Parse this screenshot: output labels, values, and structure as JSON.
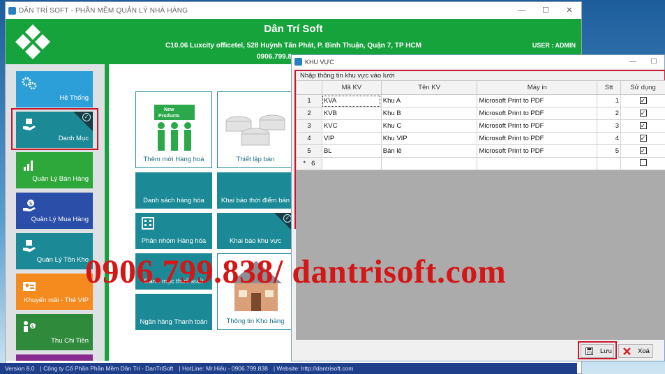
{
  "main_window": {
    "title": "DÂN TRÍ SOFT - PHẦN MỀM QUẢN LÝ NHÀ HÀNG",
    "controls": [
      "—",
      "☐",
      "✕"
    ]
  },
  "header": {
    "company_name": "Dân Trí Soft",
    "address": "C10.06 Luxcity officetel, 528 Huỳnh Tấn Phát, P. Bình Thuận, Quận 7, TP HCM",
    "phone": "0906.799.8",
    "user": "USER : ADMIN"
  },
  "sidebar": {
    "items": [
      {
        "label": "Hệ Thống",
        "icon": "gears-icon",
        "color": "#2c9fd8"
      },
      {
        "label": "Danh Mục",
        "icon": "box-hand-icon",
        "color": "#1b8a96"
      },
      {
        "label": "Quản Lý Bán Hàng",
        "icon": "bar-chart-icon",
        "color": "#2fa83b"
      },
      {
        "label": "Quản Lý Mua Hàng",
        "icon": "dollar-hand-icon",
        "color": "#2b4fa8"
      },
      {
        "label": "Quản Lý Tồn Kho",
        "icon": "box-hand-icon",
        "color": "#1b8a96"
      },
      {
        "label": "Khuyến mãi - Thẻ VIP",
        "icon": "vip-card-icon",
        "color": "#f58a1f"
      },
      {
        "label": "Thu Chi Tiền",
        "icon": "money-people-icon",
        "color": "#2f8a3b"
      }
    ]
  },
  "tiles": [
    {
      "label": "Thêm mới Hàng hoá",
      "style": "light",
      "icon": "new-products-icon"
    },
    {
      "label": "Thiết lập bàn",
      "style": "light",
      "icon": "tables-icon"
    },
    {
      "label": "Danh sách hàng hóa",
      "style": "teal"
    },
    {
      "label": "Khai báo thời điểm bán",
      "style": "teal"
    },
    {
      "label": "Phân nhóm Hàng hóa",
      "style": "teal",
      "icon": "building-icon"
    },
    {
      "label": "Khai báo khu vực",
      "style": "teal"
    },
    {
      "label": "Danh mục thuế suất",
      "style": "teal"
    },
    {
      "label": "Ngân hàng Thanh toán",
      "style": "teal"
    },
    {
      "label": "Thông tin Kho hàng",
      "style": "light",
      "icon": "house-icon"
    }
  ],
  "statusbar": {
    "version": "Version 8.0",
    "company": "Công ty Cổ Phần Phần Mềm Dân Trí - DanTriSoft",
    "hotline": "HotLine: Mr.Hiếu - 0906.799.838",
    "website": "Website: http://dantrisoft.com"
  },
  "kv_window": {
    "title": "KHU VỰC",
    "group_label": "Nhập thông tin khu vực vào lưới",
    "columns": [
      "Mã KV",
      "Tên KV",
      "Máy in",
      "Stt",
      "Sử dụng"
    ],
    "rows": [
      {
        "n": "1",
        "ma": "KVA",
        "ten": "Khu A",
        "may": "Microsoft Print to PDF",
        "stt": "1",
        "use": true
      },
      {
        "n": "2",
        "ma": "KVB",
        "ten": "Khu B",
        "may": "Microsoft Print to PDF",
        "stt": "2",
        "use": true
      },
      {
        "n": "3",
        "ma": "KVC",
        "ten": "Khu C",
        "may": "Microsoft Print to PDF",
        "stt": "3",
        "use": true
      },
      {
        "n": "4",
        "ma": "VIP",
        "ten": "Khu VIP",
        "may": "Microsoft Print to PDF",
        "stt": "4",
        "use": true
      },
      {
        "n": "5",
        "ma": "BL",
        "ten": "Bán lẻ",
        "may": "Microsoft Print to PDF",
        "stt": "5",
        "use": true
      },
      {
        "n": "6",
        "ma": "",
        "ten": "",
        "may": "",
        "stt": "",
        "use": false,
        "new_row_marker": "*"
      }
    ],
    "buttons": {
      "save": "Lưu",
      "delete": "Xoá"
    }
  },
  "watermark": "0906.799.838/ dantrisoft.com"
}
